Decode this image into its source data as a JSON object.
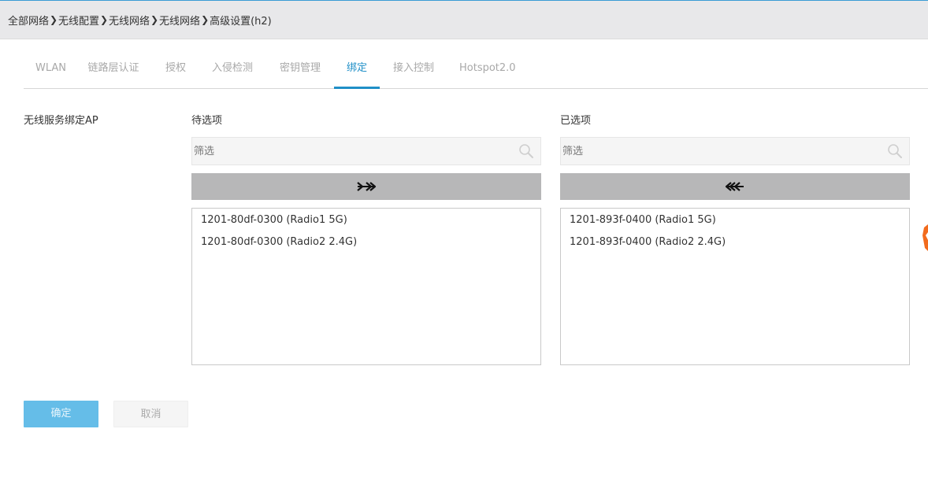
{
  "breadcrumb": {
    "items": [
      "全部网络",
      "无线配置",
      "无线网络",
      "无线网络",
      "高级设置(h2)"
    ]
  },
  "tabs": [
    {
      "label": "WLAN",
      "active": false
    },
    {
      "label": "链路层认证",
      "active": false
    },
    {
      "label": "授权",
      "active": false
    },
    {
      "label": "入侵检测",
      "active": false
    },
    {
      "label": "密钥管理",
      "active": false
    },
    {
      "label": "绑定",
      "active": true
    },
    {
      "label": "接入控制",
      "active": false
    },
    {
      "label": "Hotspot2.0",
      "active": false
    }
  ],
  "form": {
    "field_label": "无线服务绑定AP"
  },
  "available": {
    "title": "待选项",
    "filter_placeholder": "筛选",
    "items": [
      "1201-80df-0300 (Radio1 5G)",
      "1201-80df-0300 (Radio2 2.4G)"
    ]
  },
  "selected": {
    "title": "已选项",
    "filter_placeholder": "筛选",
    "items": [
      "1201-893f-0400 (Radio1 5G)",
      "1201-893f-0400 (Radio2 2.4G)"
    ]
  },
  "buttons": {
    "ok": "确定",
    "cancel": "取消"
  },
  "colors": {
    "accent": "#1f8fc7",
    "ok_button": "#65bde8",
    "move_button": "#b7b7b8",
    "edge_widget": "#f26b1d"
  }
}
